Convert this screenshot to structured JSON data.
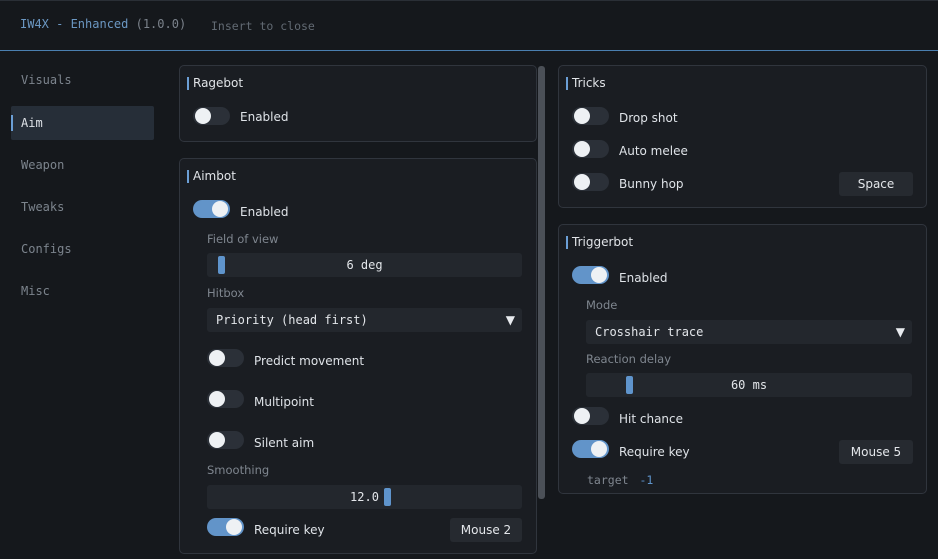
{
  "window": {
    "title": "IW4X - Enhanced",
    "version": "(1.0.0)",
    "close_hint": "Insert to close"
  },
  "sidebar": {
    "items": [
      {
        "label": "Visuals",
        "active": false
      },
      {
        "label": "Aim",
        "active": true
      },
      {
        "label": "Weapon",
        "active": false
      },
      {
        "label": "Tweaks",
        "active": false
      },
      {
        "label": "Configs",
        "active": false
      },
      {
        "label": "Misc",
        "active": false
      }
    ]
  },
  "ragebot": {
    "title": "Ragebot",
    "enabled": {
      "label": "Enabled",
      "on": false
    }
  },
  "aimbot": {
    "title": "Aimbot",
    "enabled": {
      "label": "Enabled",
      "on": true
    },
    "fov": {
      "label": "Field of view",
      "value_text": "6 deg",
      "fraction": 0.0
    },
    "hitbox": {
      "label": "Hitbox",
      "selected": "Priority (head first)"
    },
    "predict": {
      "label": "Predict movement",
      "on": false
    },
    "multipoint": {
      "label": "Multipoint",
      "on": false
    },
    "silent": {
      "label": "Silent aim",
      "on": false
    },
    "smoothing": {
      "label": "Smoothing",
      "value_text": "12.0",
      "fraction": 0.55
    },
    "require_key": {
      "label": "Require key",
      "on": true,
      "key": "Mouse 2"
    }
  },
  "tricks": {
    "title": "Tricks",
    "drop_shot": {
      "label": "Drop shot",
      "on": false
    },
    "auto_melee": {
      "label": "Auto melee",
      "on": false
    },
    "bunny_hop": {
      "label": "Bunny hop",
      "on": false,
      "key": "Space"
    }
  },
  "triggerbot": {
    "title": "Triggerbot",
    "enabled": {
      "label": "Enabled",
      "on": true
    },
    "mode": {
      "label": "Mode",
      "selected": "Crosshair trace"
    },
    "delay": {
      "label": "Reaction delay",
      "value_text": "60 ms",
      "fraction": 0.1
    },
    "hit_chance": {
      "label": "Hit chance",
      "on": false
    },
    "require_key": {
      "label": "Require key",
      "on": true,
      "key": "Mouse 5"
    },
    "target": {
      "label": "target",
      "value": "-1"
    }
  },
  "colors": {
    "accent": "#6294c9",
    "title_accent": "#6b97c2",
    "background": "#15181c",
    "panel": "#1a1d22"
  },
  "icons": {
    "dropdown": "triangle-down-icon"
  }
}
